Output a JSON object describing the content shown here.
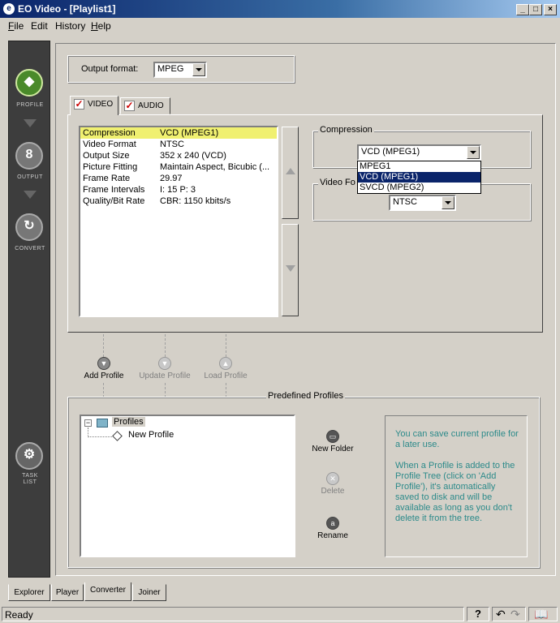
{
  "window": {
    "title": "EO Video - [Playlist1]",
    "app_icon": "eo-app-icon"
  },
  "menu": [
    {
      "label": "File",
      "underline": "F",
      "rest": "ile"
    },
    {
      "label": "Edit",
      "underline": "",
      "rest": "Edit"
    },
    {
      "label": "History",
      "underline": "",
      "rest": "History"
    },
    {
      "label": "Help",
      "underline": "H",
      "rest": "elp"
    }
  ],
  "sidebar": {
    "profile": "PROFILE",
    "output": "OUTPUT",
    "convert": "CONVERT",
    "task_list_1": "TASK",
    "task_list_2": "LIST"
  },
  "output_format": {
    "label": "Output format:",
    "value": "MPEG"
  },
  "tabs": {
    "video": "VIDEO",
    "audio": "AUDIO"
  },
  "properties": [
    {
      "key": "Compression",
      "value": "VCD (MPEG1)"
    },
    {
      "key": "Video Format",
      "value": "NTSC"
    },
    {
      "key": "Output Size",
      "value": "352 x 240 (VCD)"
    },
    {
      "key": "Picture Fitting",
      "value": "Maintain Aspect, Bicubic (..."
    },
    {
      "key": "Frame Rate",
      "value": "29.97"
    },
    {
      "key": "Frame Intervals",
      "value": "I: 15    P: 3"
    },
    {
      "key": "Quality/Bit Rate",
      "value": "CBR: 1150 kbits/s"
    }
  ],
  "compression": {
    "label": "Compression",
    "value": "VCD (MPEG1)",
    "options": [
      "MPEG1",
      "VCD (MPEG1)",
      "SVCD (MPEG2)"
    ]
  },
  "video_format": {
    "label": "Video Fo",
    "value": "NTSC"
  },
  "actions": {
    "add_profile": "Add Profile",
    "update_profile": "Update Profile",
    "load_profile": "Load Profile"
  },
  "predefined": {
    "title": "Predefined Profiles",
    "tree_root": "Profiles",
    "tree_child": "New Profile",
    "new_folder": "New Folder",
    "delete": "Delete",
    "rename": "Rename",
    "info_1": "You can save current profile for a later use.",
    "info_2": "When a Profile is added to the Profile Tree (click on 'Add Profile'), it's automatically saved to disk and will be available as long as you don't delete it from the tree."
  },
  "bottom_tabs": [
    "Explorer",
    "Player",
    "Converter",
    "Joiner"
  ],
  "status": {
    "text": "Ready",
    "help": "?"
  }
}
